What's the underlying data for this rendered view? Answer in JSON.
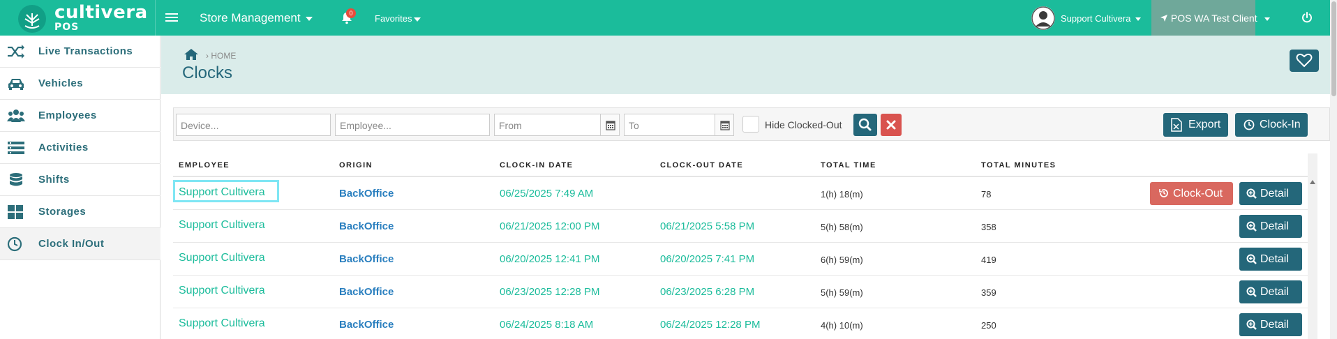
{
  "topbar": {
    "logo_main": "cultivera",
    "logo_sub": "POS",
    "store_menu": "Store Management",
    "notification_count": "0",
    "favorites": "Favorites",
    "user": "Support Cultivera",
    "client": "POS WA Test Client",
    "brand_color": "#1bbc9b"
  },
  "sidebar": {
    "items": [
      {
        "label": "Live Transactions",
        "icon": "shuffle-icon"
      },
      {
        "label": "Vehicles",
        "icon": "car-icon"
      },
      {
        "label": "Employees",
        "icon": "users-icon"
      },
      {
        "label": "Activities",
        "icon": "list-icon"
      },
      {
        "label": "Shifts",
        "icon": "database-icon"
      },
      {
        "label": "Storages",
        "icon": "grid-icon"
      },
      {
        "label": "Clock In/Out",
        "icon": "clock-icon"
      }
    ]
  },
  "header": {
    "breadcrumb": "HOME",
    "title": "Clocks"
  },
  "filters": {
    "device_placeholder": "Device...",
    "employee_placeholder": "Employee...",
    "from_placeholder": "From",
    "to_placeholder": "To",
    "hide_clocked_out": "Hide Clocked-Out",
    "export": "Export",
    "clock_in": "Clock-In"
  },
  "table": {
    "headers": [
      "EMPLOYEE",
      "ORIGIN",
      "CLOCK-IN DATE",
      "CLOCK-OUT DATE",
      "TOTAL TIME",
      "TOTAL MINUTES"
    ],
    "clock_out_label": "Clock-Out",
    "detail_label": "Detail",
    "rows": [
      {
        "employee": "Support Cultivera",
        "origin": "BackOffice",
        "clock_in": "06/25/2025 7:49 AM",
        "clock_out": "",
        "total_time": "1(h) 18(m)",
        "total_minutes": "78"
      },
      {
        "employee": "Support Cultivera",
        "origin": "BackOffice",
        "clock_in": "06/21/2025 12:00 PM",
        "clock_out": "06/21/2025 5:58 PM",
        "total_time": "5(h) 58(m)",
        "total_minutes": "358"
      },
      {
        "employee": "Support Cultivera",
        "origin": "BackOffice",
        "clock_in": "06/20/2025 12:41 PM",
        "clock_out": "06/20/2025 7:41 PM",
        "total_time": "6(h) 59(m)",
        "total_minutes": "419"
      },
      {
        "employee": "Support Cultivera",
        "origin": "BackOffice",
        "clock_in": "06/23/2025 12:28 PM",
        "clock_out": "06/23/2025 6:28 PM",
        "total_time": "5(h) 59(m)",
        "total_minutes": "359"
      },
      {
        "employee": "Support Cultivera",
        "origin": "BackOffice",
        "clock_in": "06/24/2025 8:18 AM",
        "clock_out": "06/24/2025 12:28 PM",
        "total_time": "4(h) 10(m)",
        "total_minutes": "250"
      }
    ]
  }
}
